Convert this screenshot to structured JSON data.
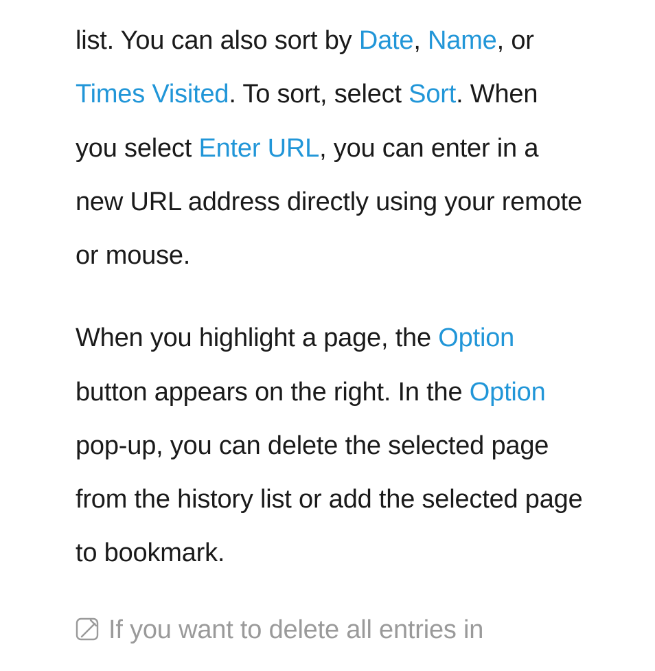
{
  "para1": {
    "t1": "list. You can also sort by ",
    "date": "Date",
    "sep1": ", ",
    "name": "Name",
    "sep2": ", or ",
    "times_visited": "Times Visited",
    "t2": ". To sort, select ",
    "sort": "Sort",
    "t3": ". When you select ",
    "enter_url": "Enter URL",
    "t4": ", you can enter in a new URL address directly using your remote or mouse."
  },
  "para2": {
    "t1": "When you highlight a page, the ",
    "option1": "Option",
    "t2": " button appears on the right. In the ",
    "option2": "Option",
    "t3": " pop-up, you can delete the selected page from the history list or add the selected page to bookmark."
  },
  "note": {
    "text": "If you want to delete all entries in"
  }
}
